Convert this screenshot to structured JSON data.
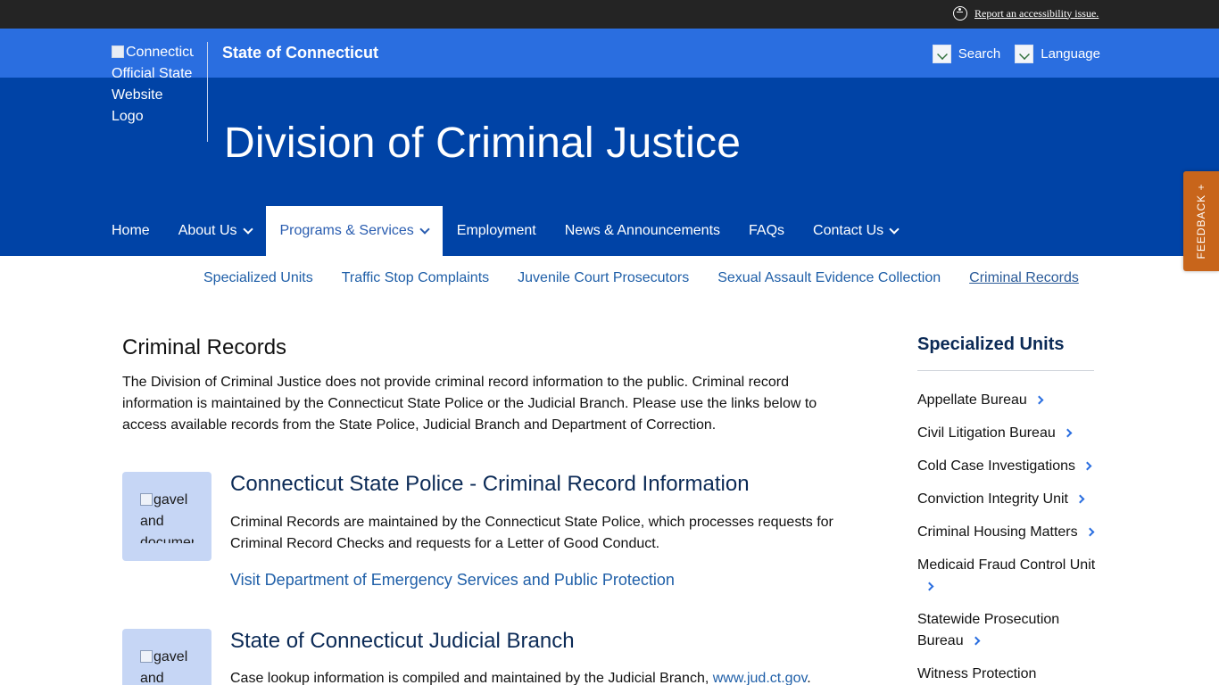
{
  "accessibility": {
    "link_text": "Report an accessibility issue."
  },
  "header": {
    "logo_alt_lines": [
      "Connecticut's",
      "Official State",
      "Website",
      "Logo"
    ],
    "state_title": "State of Connecticut",
    "search_label": "Search",
    "language_label": "Language",
    "site_title": "Division of Criminal Justice"
  },
  "main_nav": [
    {
      "label": "Home",
      "dropdown": false
    },
    {
      "label": "About Us",
      "dropdown": true
    },
    {
      "label": "Programs & Services",
      "dropdown": true,
      "active": true
    },
    {
      "label": "Employment",
      "dropdown": false
    },
    {
      "label": "News & Announcements",
      "dropdown": false
    },
    {
      "label": "FAQs",
      "dropdown": false
    },
    {
      "label": "Contact Us",
      "dropdown": true
    }
  ],
  "sub_nav": [
    {
      "label": "Specialized Units"
    },
    {
      "label": "Traffic Stop Complaints"
    },
    {
      "label": "Juvenile Court Prosecutors"
    },
    {
      "label": "Sexual Assault Evidence Collection"
    },
    {
      "label": "Criminal Records",
      "current": true
    }
  ],
  "content": {
    "heading": "Criminal Records",
    "intro": "The Division of Criminal Justice does not provide criminal record information to the public. Criminal record information is maintained by the Connecticut State Police or the Judicial Branch. Please use the links below to access available records from the State Police, Judicial Branch and Department of Correction.",
    "cards": [
      {
        "image_alt": "gavel and documents",
        "title": "Connecticut State Police - Criminal Record Information",
        "text": "Criminal Records are maintained by the Connecticut State Police, which processes requests for Criminal Record Checks and requests for a Letter of Good Conduct.",
        "link": "Visit Department of Emergency Services and Public Protection"
      },
      {
        "image_alt": "gavel and documents",
        "title": "State of Connecticut Judicial Branch",
        "text": "Case lookup information is compiled and maintained by the Judicial Branch,",
        "inline_link": "www.jud.ct.gov",
        "text_end": "."
      }
    ]
  },
  "sidebar": {
    "heading": "Specialized Units",
    "items": [
      "Appellate Bureau",
      "Civil Litigation Bureau",
      "Cold Case Investigations",
      "Conviction Integrity Unit",
      "Criminal Housing Matters",
      "Medicaid Fraud Control Unit",
      "Statewide Prosecution Bureau",
      "Witness Protection"
    ]
  },
  "feedback": {
    "label": "FEEDBACK +"
  },
  "colors": {
    "top_bar": "#242424",
    "state_bar": "#2a6ee0",
    "masthead": "#0043a6",
    "link": "#1f5fa8",
    "feedback": "#c8651b"
  }
}
